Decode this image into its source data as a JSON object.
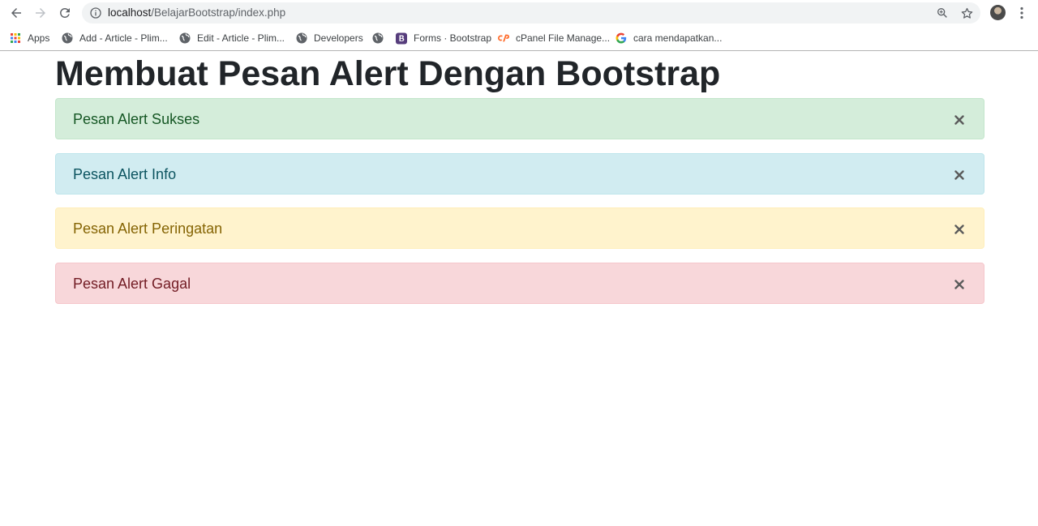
{
  "browser": {
    "url_host": "localhost",
    "url_path": "/BelajarBootstrap/index.php"
  },
  "bookmarks": [
    {
      "label": "Apps",
      "icon": "apps-grid-icon"
    },
    {
      "label": "Add - Article - Plim...",
      "icon": "globe-icon"
    },
    {
      "label": "Edit - Article - Plim...",
      "icon": "globe-icon"
    },
    {
      "label": "Developers",
      "icon": "globe-icon"
    },
    {
      "label": "",
      "icon": "globe-icon"
    },
    {
      "label": "Forms · Bootstrap",
      "icon": "bootstrap-logo-icon"
    },
    {
      "label": "cPanel File Manage...",
      "icon": "cpanel-logo-icon"
    },
    {
      "label": "cara mendapatkan...",
      "icon": "google-logo-icon"
    }
  ],
  "page": {
    "title": "Membuat Pesan Alert Dengan Bootstrap"
  },
  "alerts": [
    {
      "text": "Pesan Alert Sukses",
      "type": "success",
      "bg": "#d4edda",
      "border": "#c3e6cb",
      "color": "#155724"
    },
    {
      "text": "Pesan Alert Info",
      "type": "info",
      "bg": "#d1ecf1",
      "border": "#bee5eb",
      "color": "#0c5460"
    },
    {
      "text": "Pesan Alert Peringatan",
      "type": "warning",
      "bg": "#fff3cd",
      "border": "#ffeeba",
      "color": "#856404"
    },
    {
      "text": "Pesan Alert Gagal",
      "type": "danger",
      "bg": "#f8d7da",
      "border": "#f5c6cb",
      "color": "#721c24"
    }
  ],
  "icons": {
    "close": "close-icon"
  }
}
